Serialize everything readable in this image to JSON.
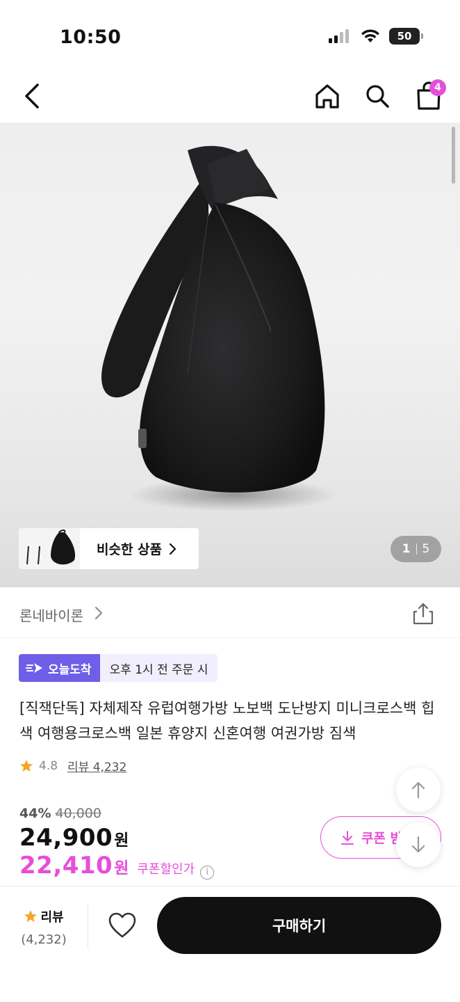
{
  "status_bar": {
    "time": "10:50",
    "battery": "50"
  },
  "nav": {
    "cart_count": "4"
  },
  "gallery": {
    "similar_label": "비슷한 상품",
    "current_page": "1",
    "total_pages": "5"
  },
  "brand": {
    "name": "론네바이론"
  },
  "delivery": {
    "badge": "오늘도착",
    "cutoff": "오후 1시 전 주문 시"
  },
  "product": {
    "title": "[직잭단독] 자체제작 유럽여행가방 노보백 도난방지 미니크로스백 힙색 여행용크로스백 일본 휴양지 신혼여행 여권가방 짐색",
    "rating": "4.8",
    "review_text": "리뷰 4,232"
  },
  "pricing": {
    "discount_pct": "44%",
    "original_price": "40,000",
    "price": "24,900",
    "price_unit": "원",
    "coupon_price": "22,410",
    "coupon_unit": "원",
    "coupon_label": "쿠폰할인가",
    "coupon_button": "쿠폰 받"
  },
  "bottom_bar": {
    "review_label": "리뷰",
    "review_count": "(4,232)",
    "buy_label": "구매하기"
  },
  "colors": {
    "accent_pink": "#e64fd9",
    "delivery_purple": "#6f5ee8",
    "star": "#f5a623"
  }
}
